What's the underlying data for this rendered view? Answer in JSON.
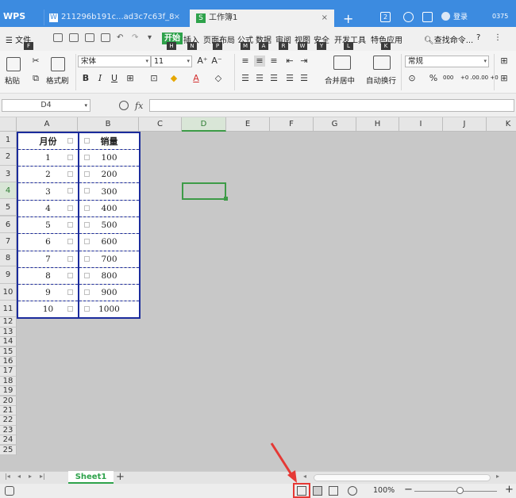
{
  "titlebar": {
    "app": "WPS",
    "tabs": [
      {
        "label": "211296b191c...ad3c7c63f_8",
        "icon": "W",
        "close": "×"
      },
      {
        "label": "工作簿1",
        "icon": "S",
        "close": "×"
      }
    ],
    "add_tab": "+",
    "badge": "2",
    "login": "登录",
    "version": "0375"
  },
  "menu": {
    "file": "文件",
    "items": [
      "开始",
      "插入",
      "页面布局",
      "公式",
      "数据",
      "审阅",
      "视图",
      "安全",
      "开发工具",
      "特色应用"
    ],
    "search": "查找命令...",
    "help": "?",
    "more": "⋮",
    "hotkeys": [
      "F",
      "H",
      "N",
      "P",
      "M",
      "A",
      "R",
      "W",
      "Y",
      "L",
      "K"
    ]
  },
  "ribbon": {
    "paste": "粘贴",
    "format_painter": "格式刷",
    "font_name": "宋体",
    "font_size": "11",
    "merge_center": "合并居中",
    "wrap_text": "自动换行",
    "number_format": "常规",
    "percent": "%",
    "thousands": "000",
    "dec_inc": "+0 .00",
    "dec_dec": ".00 +0"
  },
  "formula_bar": {
    "cell_ref": "D4",
    "fx": "fx",
    "value": ""
  },
  "grid": {
    "columns": [
      "A",
      "B",
      "C",
      "D",
      "E",
      "F",
      "G",
      "H",
      "I",
      "J",
      "K"
    ],
    "active_column": "D",
    "rows": [
      "1",
      "2",
      "3",
      "4",
      "5",
      "6",
      "7",
      "8",
      "9",
      "10",
      "11",
      "12",
      "13",
      "14",
      "15",
      "16",
      "17",
      "18",
      "19",
      "20",
      "21",
      "22",
      "23",
      "24",
      "25"
    ],
    "active_row": "4",
    "header": [
      "月份",
      "销量"
    ],
    "data": [
      [
        "1",
        "100"
      ],
      [
        "2",
        "200"
      ],
      [
        "3",
        "300"
      ],
      [
        "4",
        "400"
      ],
      [
        "5",
        "500"
      ],
      [
        "6",
        "600"
      ],
      [
        "7",
        "700"
      ],
      [
        "8",
        "800"
      ],
      [
        "9",
        "900"
      ],
      [
        "10",
        "1000"
      ]
    ]
  },
  "sheets": {
    "tabs": [
      "Sheet1"
    ],
    "add": "+"
  },
  "status": {
    "zoom": "100%",
    "zoom_minus": "−",
    "zoom_plus": "+"
  },
  "colors": {
    "title_bg": "#3c8be0",
    "accent_green": "#2ea24b",
    "table_border": "#1b2b9c",
    "highlight_red": "#e53935"
  }
}
